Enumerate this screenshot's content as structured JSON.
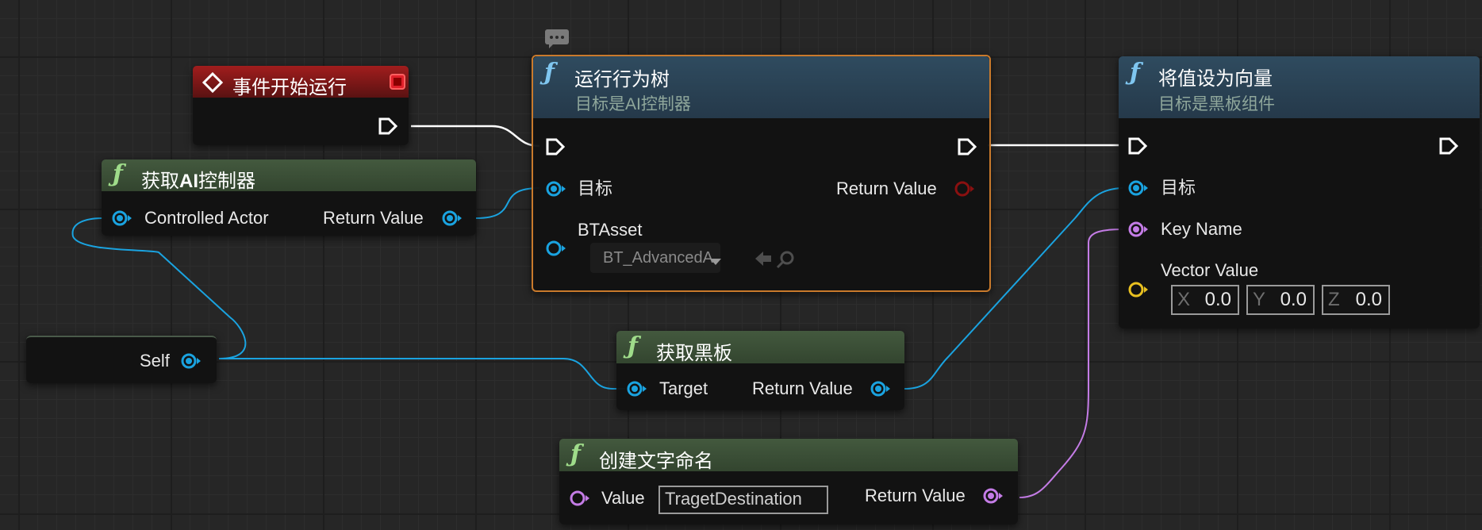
{
  "comment_icon": "speech-bubble-icon",
  "nodes": {
    "event_begin_play": {
      "title": "事件开始运行",
      "icon": "event-diamond-icon",
      "delegate_icon": "red-square-delegate-icon"
    },
    "get_ai_controller": {
      "title_prefix": "获取",
      "title_bold": "AI",
      "title_suffix": "控制器",
      "input_label": "Controlled Actor",
      "output_label": "Return Value"
    },
    "self_node": {
      "label": "Self"
    },
    "run_behavior_tree": {
      "title": "运行行为树",
      "subtitle": "目标是AI控制器",
      "target_label": "目标",
      "return_label": "Return Value",
      "btasset_label": "BTAsset",
      "btasset_value": "BT_AdvancedA"
    },
    "get_blackboard": {
      "title": "获取黑板",
      "input_label": "Target",
      "output_label": "Return Value"
    },
    "make_literal_name": {
      "title": "创建文字命名",
      "input_label": "Value",
      "input_value": "TragetDestination",
      "output_label": "Return Value"
    },
    "set_value_as_vector": {
      "title": "将值设为向量",
      "subtitle": "目标是黑板组件",
      "target_label": "目标",
      "key_label": "Key Name",
      "vector_label": "Vector Value",
      "x_axis": "X",
      "x_value": "0.0",
      "y_axis": "Y",
      "y_value": "0.0",
      "z_axis": "Z",
      "z_value": "0.0"
    }
  },
  "colors": {
    "exec": "#ffffff",
    "object_pin": "#1aa3e0",
    "name_pin": "#c47ce6",
    "vector_pin": "#e8c020",
    "return_red_pin": "#8a1010",
    "selected_outline": "#c97a2c"
  }
}
